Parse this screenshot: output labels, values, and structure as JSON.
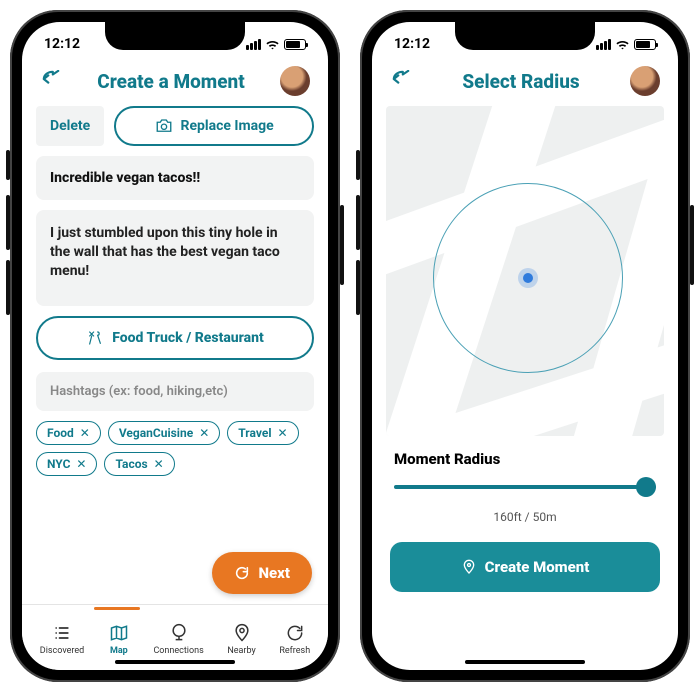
{
  "status": {
    "time": "12:12"
  },
  "left": {
    "header_title": "Create a Moment",
    "delete_label": "Delete",
    "replace_label": "Replace Image",
    "moment_title": "Incredible vegan tacos!!",
    "moment_body": "I just stumbled upon this tiny hole in the wall that has the best vegan taco menu!",
    "category": "Food Truck / Restaurant",
    "hashtag_placeholder": "Hashtags (ex: food, hiking,etc)",
    "chips": [
      "Food",
      "VeganCuisine",
      "Travel",
      "NYC",
      "Tacos"
    ],
    "next_label": "Next",
    "tabs": [
      "Discovered",
      "Map",
      "Connections",
      "Nearby",
      "Refresh"
    ]
  },
  "right": {
    "header_title": "Select Radius",
    "radius_label": "Moment Radius",
    "distance": "160ft / 50m",
    "create_label": "Create Moment"
  }
}
